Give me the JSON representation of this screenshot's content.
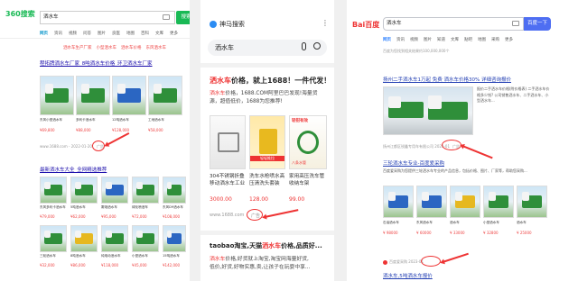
{
  "panel1": {
    "logo": "360搜索",
    "query": "洒水车",
    "search_button": "搜索",
    "tabs": [
      "资讯",
      "视频",
      "问答",
      "图片",
      "良医",
      "地图",
      "百科",
      "文库",
      "更多"
    ],
    "related": [
      "洒水车生产厂家",
      "小型洒水车",
      "洒水车价格",
      "东风洒水车",
      "洒水车图片"
    ],
    "ad_title": "程拓牌洒水车厂家_8吨洒水车价格_环卫洒水车厂家",
    "ad_items": [
      {
        "label": "东风小型洒水车",
        "price": "¥69,800"
      },
      {
        "label": "多利卡洒水车",
        "price": "¥88,000"
      },
      {
        "label": "12吨洒水车",
        "price": "¥128,000"
      },
      {
        "label": "工地洒水车",
        "price": "¥58,000"
      }
    ],
    "ad_source": "www.1688.com - 2022-01-20",
    "ad_tag": "广告",
    "result2_title": "最新洒水车大全_全网精选推荐",
    "result2_items": [
      {
        "label": "东风多利卡洒水车",
        "price": "¥79,000"
      },
      {
        "label": "5吨洒水车",
        "price": "¥62,000"
      },
      {
        "label": "雾炮洒水车",
        "price": "¥95,000"
      },
      {
        "label": "绿化喷洒车",
        "price": "¥72,000"
      },
      {
        "label": "东风D9洒水车",
        "price": "¥108,000"
      },
      {
        "label": "三轮洒水车",
        "price": "¥32,000"
      },
      {
        "label": "8吨洒水车",
        "price": "¥86,000"
      },
      {
        "label": "纯电动洒水车",
        "price": "¥118,000"
      },
      {
        "label": "小型洒水车",
        "price": "¥45,000"
      },
      {
        "label": "15吨洒水车",
        "price": "¥142,000"
      }
    ]
  },
  "panel2": {
    "logo": "神马搜索",
    "query": "洒水车",
    "result1_title_pre": "洒水车",
    "result1_title_post": "价格，就上1688！一件代发！",
    "result1_desc_pre": "洒水车",
    "result1_desc_post": "价格，1688.COM阿里巴巴发现!海量货源，超值低价，1688为您推荐!",
    "cards": [
      {
        "caption": "304不锈钢折叠移动洒水车工业",
        "price": "3000.00"
      },
      {
        "caption": "洗车水枪喷水高压清洗头套装",
        "price": "128.00"
      },
      {
        "caption": "家用高压洗车管收纳车架",
        "price": "99.00"
      }
    ],
    "card_badge": "轻轻推拉",
    "card_badge2": "轻钳有效",
    "card_badge3": "八条水管",
    "source": "www.1688.com",
    "ad_tag": "广告",
    "result2_title_pre": "taobao淘宝,天猫",
    "result2_title_mid": "洒水车",
    "result2_title_post": "价格,品质好...",
    "result2_desc_pre": "洒水车",
    "result2_desc_post": "价格,好货就上淘宝,淘宝网海量好货,",
    "result2_desc2": "低价,好货,好物实惠,卖,让孩子在玩耍中享..."
  },
  "panel3": {
    "logo": "Bai百度",
    "query": "洒水车",
    "search_button": "百度一下",
    "tabs": [
      "网页",
      "资讯",
      "视频",
      "图片",
      "知道",
      "文库",
      "贴吧",
      "地图",
      "采购",
      "更多"
    ],
    "stats": "百度为您找到相关结果约100,000,000个",
    "ad_title": "扬州二手洒水车1万起 免费 洒水车价格30% 详细咨询报价",
    "ad_desc": "报价二手洒水车价格(附价格表) 二手洒水车价格多少钱? 公司销售洒水车、二手洒水车、小型洒水车...",
    "ad_source": "扬州江都区锐鑫专用车有限公司 2023-01",
    "ad_tag": "广告",
    "result2_title": "三轮洒水车专业-百度爱采购",
    "result2_desc": "百度爱采购为您提供三轮洒水车专业的产品信息，包括价格、图片、厂家等，帮助您采购...",
    "result2_items": [
      {
        "label": "石油洒水车",
        "price": "¥ 98000"
      },
      {
        "label": "东风洒水车",
        "price": "¥ 60000"
      },
      {
        "label": "洒水车",
        "price": "¥ 33000"
      },
      {
        "label": "小型洒水车",
        "price": "¥ 32800"
      },
      {
        "label": "洒水车",
        "price": "¥ 25000"
      }
    ],
    "result2_source": "百度爱采购 2023-01",
    "result3_title": "洒水车,5吨洒水车报价"
  },
  "colors": {
    "accent_360": "#19b955",
    "baidu_blue": "#4e6ef2",
    "highlight": "#e33"
  }
}
